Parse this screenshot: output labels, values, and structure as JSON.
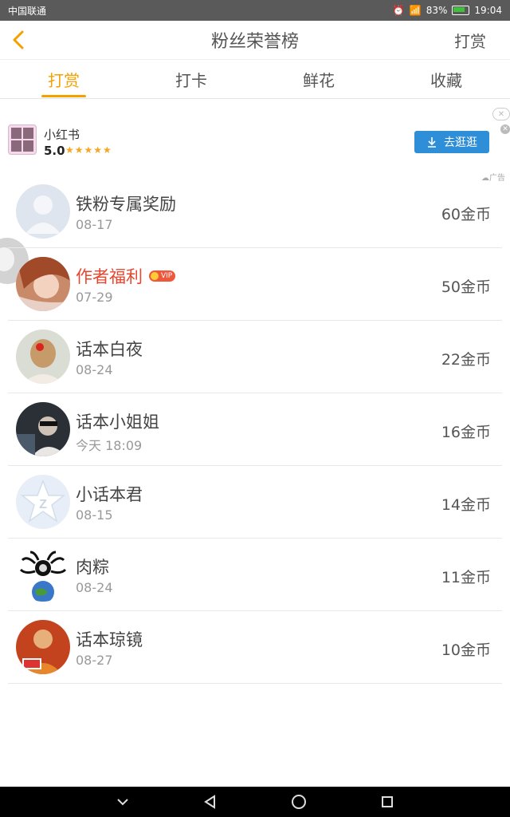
{
  "status_bar": {
    "carrier": "中国联通",
    "battery": "83%",
    "time": "19:04"
  },
  "header": {
    "title": "粉丝荣誉榜",
    "action": "打赏"
  },
  "tabs": [
    {
      "label": "打赏",
      "active": true
    },
    {
      "label": "打卡",
      "active": false
    },
    {
      "label": "鲜花",
      "active": false
    },
    {
      "label": "收藏",
      "active": false
    }
  ],
  "ad": {
    "name": "小红书",
    "rating": "5.0",
    "stars": "★★★★★",
    "button": "去逛逛",
    "tag": "广告"
  },
  "fans": [
    {
      "name": "铁粉专属奖励",
      "date": "08-17",
      "coins": "60金币",
      "vip": false
    },
    {
      "name": "作者福利",
      "date": "07-29",
      "coins": "50金币",
      "vip": true,
      "badge": "VIP"
    },
    {
      "name": "话本白夜",
      "date": "08-24",
      "coins": "22金币",
      "vip": false
    },
    {
      "name": "话本小姐姐",
      "date": "今天 18:09",
      "coins": "16金币",
      "vip": false
    },
    {
      "name": "小话本君",
      "date": "08-15",
      "coins": "14金币",
      "vip": false
    },
    {
      "name": "肉粽",
      "date": "08-24",
      "coins": "11金币",
      "vip": false
    },
    {
      "name": "话本琼镜",
      "date": "08-27",
      "coins": "10金币",
      "vip": false
    }
  ],
  "colors": {
    "accent": "#f4a100",
    "vip_name": "#e8452d",
    "ad_button": "#2f8ed8"
  }
}
